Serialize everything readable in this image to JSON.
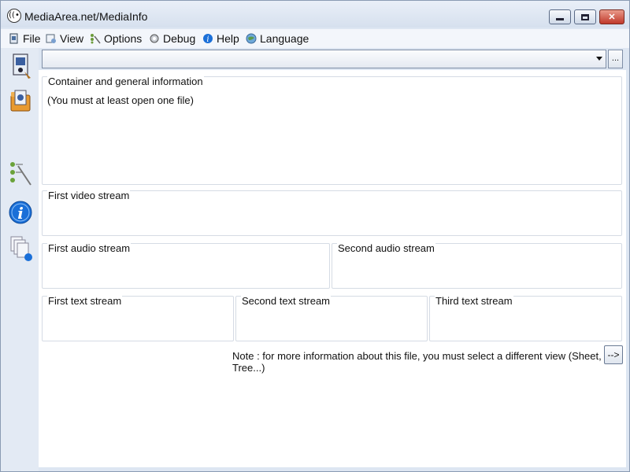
{
  "window": {
    "title": "MediaArea.net/MediaInfo"
  },
  "menu": [
    {
      "label": "File",
      "icon": "file-icon"
    },
    {
      "label": "View",
      "icon": "view-icon"
    },
    {
      "label": "Options",
      "icon": "options-icon"
    },
    {
      "label": "Debug",
      "icon": "debug-icon"
    },
    {
      "label": "Help",
      "icon": "help-icon"
    },
    {
      "label": "Language",
      "icon": "language-icon"
    }
  ],
  "sidebar": [
    {
      "name": "open-file-icon"
    },
    {
      "name": "open-folder-icon"
    },
    {
      "name": "view-tree-icon"
    },
    {
      "name": "info-icon"
    },
    {
      "name": "export-icon"
    }
  ],
  "file_selector": {
    "value": "",
    "browse_label": "..."
  },
  "groups": {
    "general": {
      "label": "Container and general information",
      "body": "(You must at least open one file)"
    },
    "video1": {
      "label": "First video stream"
    },
    "audio1": {
      "label": "First audio stream"
    },
    "audio2": {
      "label": "Second audio stream"
    },
    "text1": {
      "label": "First text stream"
    },
    "text2": {
      "label": "Second text stream"
    },
    "text3": {
      "label": "Third text stream"
    }
  },
  "note": "Note : for more information about this file, you must select a different view (Sheet, Tree...)",
  "next_view_button": "-->",
  "colors": {
    "window_bg": "#dde6f2",
    "close_button": "#c0392b",
    "info_blue": "#1a6fd8"
  }
}
